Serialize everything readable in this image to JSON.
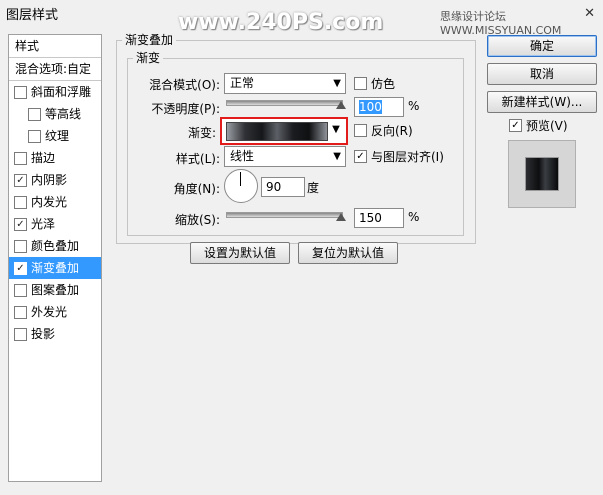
{
  "window": {
    "title": "图层样式"
  },
  "watermark": {
    "text": "www.240PS.com",
    "site": "思缘设计论坛 WWW.MISSYUAN.COM"
  },
  "left_panel": {
    "header": "样式",
    "blend_options": "混合选项:自定",
    "items": [
      {
        "label": "斜面和浮雕",
        "checked": false,
        "mark": ""
      },
      {
        "label": "等高线",
        "checked": false,
        "mark": ""
      },
      {
        "label": "纹理",
        "checked": false,
        "mark": ""
      },
      {
        "label": "描边",
        "checked": false,
        "mark": ""
      },
      {
        "label": "内阴影",
        "checked": true,
        "mark": "✓"
      },
      {
        "label": "内发光",
        "checked": false,
        "mark": ""
      },
      {
        "label": "光泽",
        "checked": true,
        "mark": "✓"
      },
      {
        "label": "颜色叠加",
        "checked": false,
        "mark": ""
      },
      {
        "label": "渐变叠加",
        "checked": true,
        "mark": "✓",
        "selected": true
      },
      {
        "label": "图案叠加",
        "checked": false,
        "mark": ""
      },
      {
        "label": "外发光",
        "checked": false,
        "mark": ""
      },
      {
        "label": "投影",
        "checked": false,
        "mark": ""
      }
    ]
  },
  "gradient_overlay": {
    "group_title": "渐变叠加",
    "sub_title": "渐变",
    "blend_mode_label": "混合模式(O):",
    "blend_mode_value": "正常",
    "dither_label": "仿色",
    "dither_mark": "",
    "opacity_label": "不透明度(P):",
    "opacity_value": "100",
    "opacity_unit": "%",
    "opacity_level": 1.0,
    "gradient_label": "渐变:",
    "reverse_label": "反向(R)",
    "reverse_mark": "",
    "style_label": "样式(L):",
    "style_value": "线性",
    "align_label": "与图层对齐(I)",
    "align_mark": "✓",
    "angle_label": "角度(N):",
    "angle_value": "90",
    "angle_unit": "度",
    "scale_label": "缩放(S):",
    "scale_value": "150",
    "scale_unit": "%",
    "scale_level": 1.0,
    "btn_set_default": "设置为默认值",
    "btn_reset_default": "复位为默认值"
  },
  "buttons": {
    "ok": "确定",
    "cancel": "取消",
    "new_style": "新建样式(W)...",
    "preview_label": "预览(V)",
    "preview_mark": "✓"
  },
  "colors": {
    "selection": "#3399ff",
    "highlight_box": "#e21b1b"
  }
}
